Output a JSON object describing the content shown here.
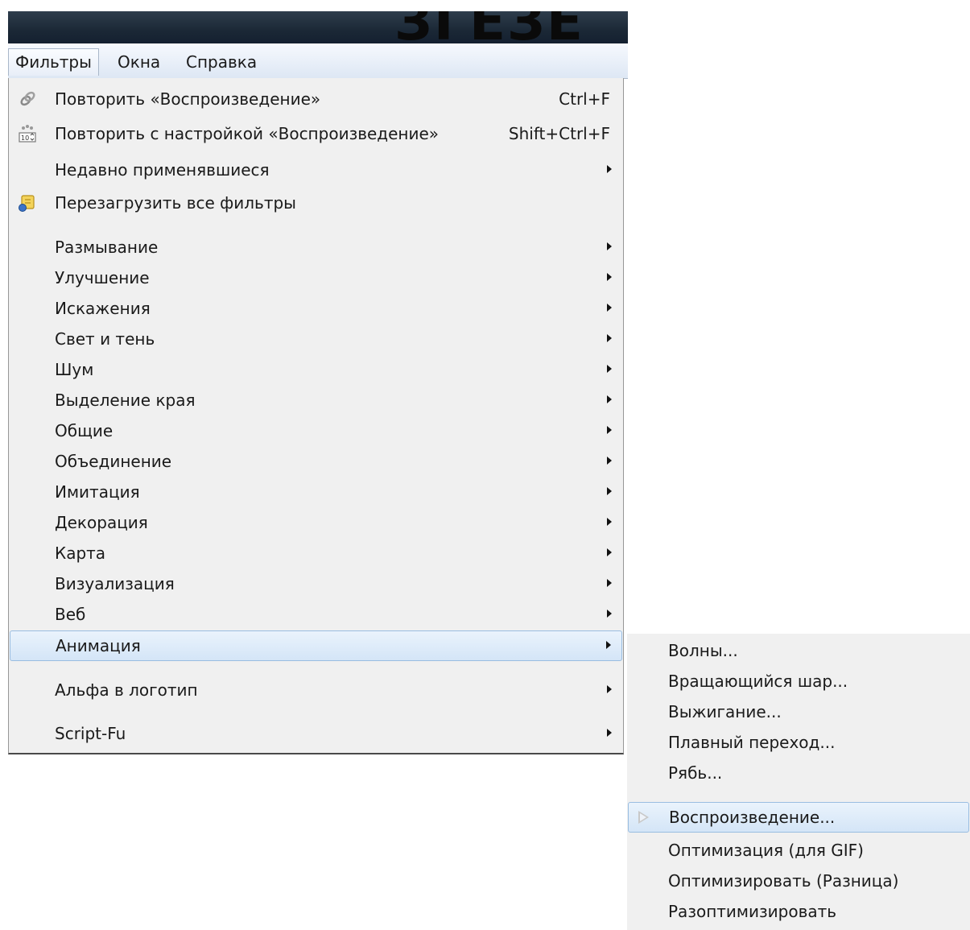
{
  "menubar": {
    "items": [
      {
        "label": "Фильтры",
        "active": true
      },
      {
        "label": "Окна",
        "active": false
      },
      {
        "label": "Справка",
        "active": false
      }
    ]
  },
  "filters_menu": {
    "repeat": {
      "label": "Повторить «Воспроизведение»",
      "accel": "Ctrl+F",
      "icon": "repeat-icon"
    },
    "reshow": {
      "label": "Повторить с настройкой «Воспроизведение»",
      "accel": "Shift+Ctrl+F",
      "icon": "settings-dialog-icon"
    },
    "recent": {
      "label": "Недавно применявшиеся"
    },
    "reload": {
      "label": "Перезагрузить все фильтры",
      "icon": "reload-icon"
    },
    "categories": [
      "Размывание",
      "Улучшение",
      "Искажения",
      "Свет и тень",
      "Шум",
      "Выделение края",
      "Общие",
      "Объединение",
      "Имитация",
      "Декорация",
      "Карта",
      "Визуализация",
      "Веб",
      "Анимация"
    ],
    "alpha_to_logo": "Альфа в логотип",
    "script_fu": "Script-Fu"
  },
  "animation_submenu": {
    "items": [
      "Волны...",
      "Вращающийся шар...",
      "Выжигание...",
      "Плавный переход...",
      "Рябь...",
      "Воспроизведение...",
      "Оптимизация (для GIF)",
      "Оптимизировать (Разница)",
      "Разоптимизировать"
    ],
    "highlighted": "Воспроизведение..."
  },
  "colors": {
    "highlight": "#d4e5f7",
    "highlight_border": "#99bde1",
    "menu_bg": "#f0f0f0",
    "titlebar": "#1b2836"
  }
}
